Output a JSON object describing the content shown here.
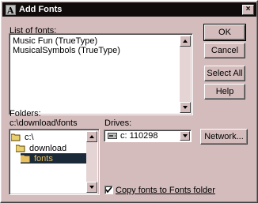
{
  "window": {
    "title": "Add Fonts",
    "close_label": "×"
  },
  "fonts": {
    "label": "List of fonts:",
    "items": [
      "Music Fun (TrueType)",
      "MusicalSymbols (TrueType)"
    ]
  },
  "buttons": {
    "ok": "OK",
    "cancel": "Cancel",
    "select_all": "Select All",
    "help": "Help",
    "network": "Network..."
  },
  "folders": {
    "label": "Folders:",
    "path": "c:\\download\\fonts",
    "tree": [
      "c:\\",
      "download",
      "fonts"
    ],
    "selected_index": 2
  },
  "drives": {
    "label": "Drives:",
    "selected": "c: 110298"
  },
  "copy_option": {
    "label": "Copy fonts to Fonts folder",
    "checked": true
  },
  "colors": {
    "dialog_bg": "#d4bcbc",
    "titlebar": "#100c0c",
    "selection_bg": "#1a2a38",
    "selection_text": "#e8c060"
  }
}
